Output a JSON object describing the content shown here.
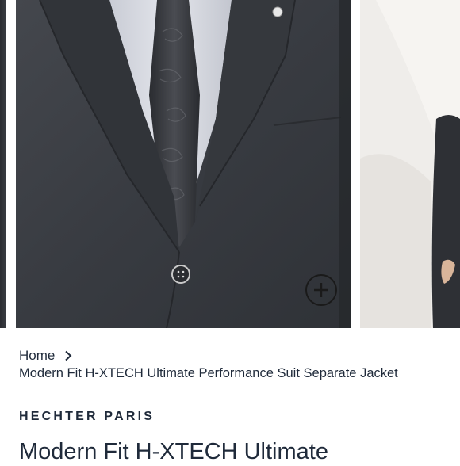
{
  "gallery": {
    "main_image_alt": "",
    "zoom_icon": "plus-circle-icon"
  },
  "breadcrumb": {
    "home_label": "Home",
    "separator_icon": "chevron-right-icon",
    "current_label": "Modern Fit H-XTECH Ultimate Performance Suit Separate Jacket"
  },
  "product": {
    "brand": "HECHTER PARIS",
    "title": "Modern Fit H-XTECH Ultimate"
  },
  "colors": {
    "text": "#1f2a3a",
    "jacket": "#3b3e44",
    "shirt": "#d9dbe2"
  }
}
